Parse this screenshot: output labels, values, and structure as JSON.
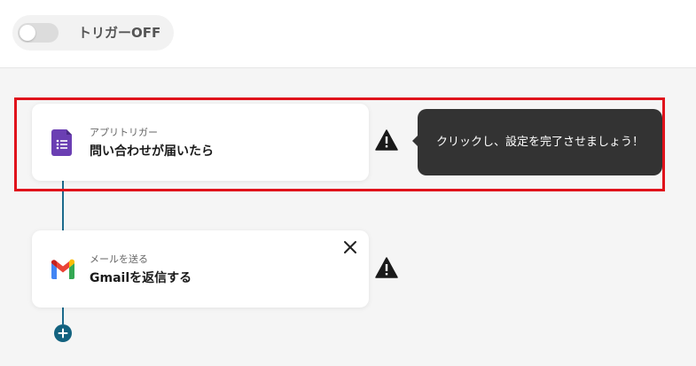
{
  "topbar": {
    "trigger_label": "トリガーOFF",
    "toggle_state": "off"
  },
  "steps": [
    {
      "type_label": "アプリトリガー",
      "title": "問い合わせが届いたら",
      "icon": "google-forms-icon",
      "status_icon": "warning-icon"
    },
    {
      "type_label": "メールを送る",
      "title": "Gmailを返信する",
      "icon": "gmail-icon",
      "status_icon": "warning-icon"
    }
  ],
  "tooltip": {
    "text": "クリックし、設定を完了させましょう！"
  },
  "colors": {
    "highlight_border": "#e0121b",
    "connector": "#1c6a8c",
    "add_button": "#13627f",
    "tooltip_bg": "#333333",
    "forms_purple": "#6b3fb3"
  }
}
